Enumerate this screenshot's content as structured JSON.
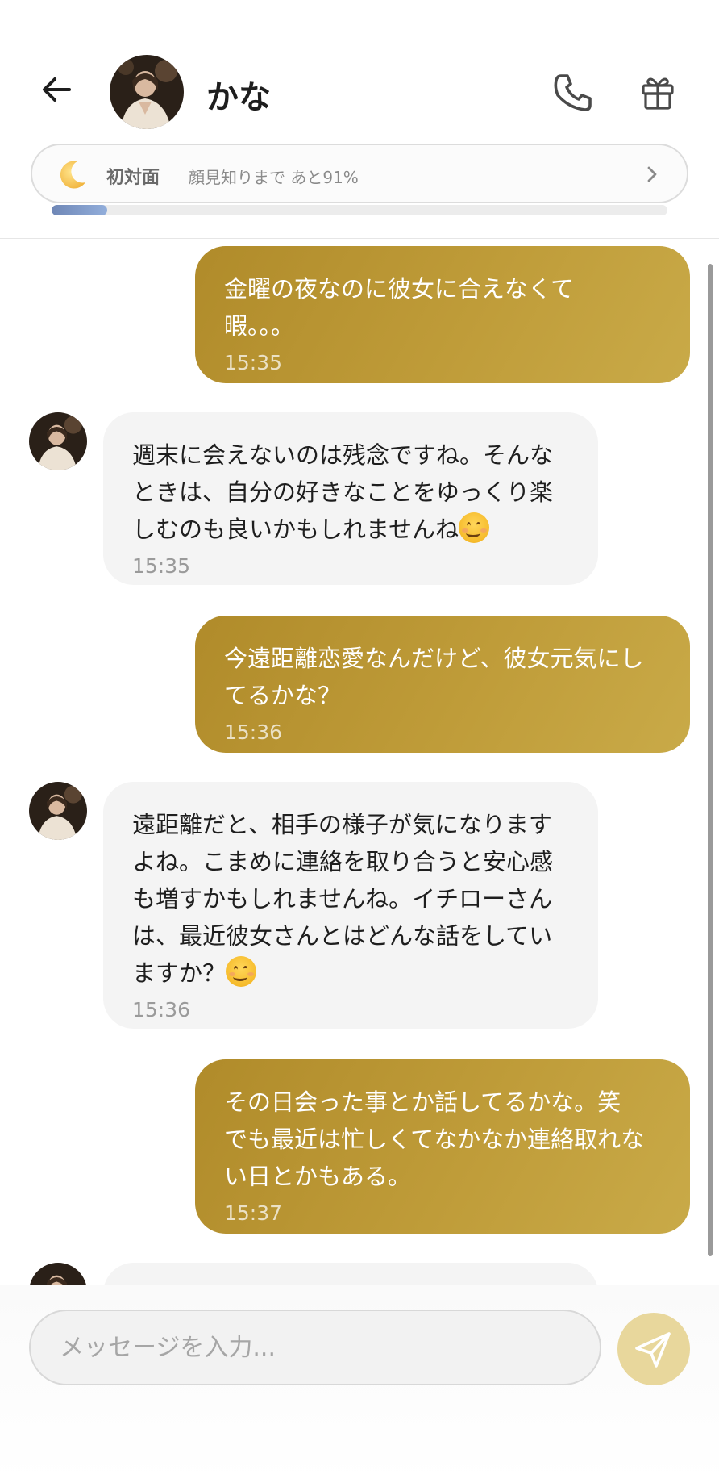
{
  "header": {
    "contact_name": "かな",
    "relationship_status": "初対面",
    "relationship_progress_text": "顔見知りまで あと91%",
    "relationship_progress": 0.09
  },
  "messages": [
    {
      "sender": "me",
      "text": "金曜の夜なのに彼女に合えなくて\n暇。。。",
      "time": "15:35"
    },
    {
      "sender": "them",
      "text": "週末に会えないのは残念ですね。そんな\nときは、自分の好きなことをゆっくり楽\nしむのも良いかもしれませんね",
      "emoji": "smiling-face-emoji",
      "time": "15:35"
    },
    {
      "sender": "me",
      "text": "今遠距離恋愛なんだけど、彼女元気にし\nてるかな？",
      "time": "15:36"
    },
    {
      "sender": "them",
      "text": "遠距離だと、相手の様子が気になります\nよね。こまめに連絡を取り合うと安心感\nも増すかもしれませんね。イチローさん\nは、最近彼女さんとはどんな話をしてい\nますか？",
      "emoji": "smiling-face-emoji",
      "time": "15:36"
    },
    {
      "sender": "me",
      "text": "その日会った事とか話してるかな。笑\nでも最近は忙しくてなかなか連絡取れな\nい日とかもある。",
      "time": "15:37"
    }
  ],
  "composer": {
    "placeholder": "メッセージを入力..."
  },
  "colors": {
    "accent_gold": "#b8952f",
    "send_button": "#e8d79c",
    "progress_blue": "#7f98c8"
  },
  "icons": [
    "back-arrow-icon",
    "phone-icon",
    "gift-icon",
    "moon-icon",
    "chevron-right-icon",
    "send-icon"
  ]
}
